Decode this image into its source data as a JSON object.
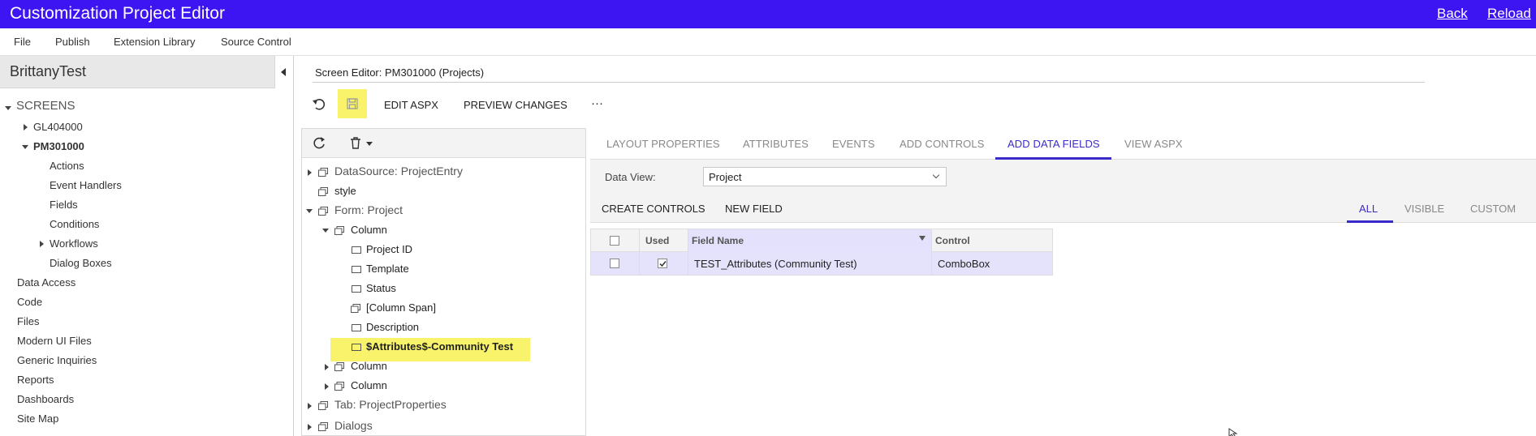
{
  "app": {
    "title": "Customization Project Editor",
    "back_label": "Back",
    "reload_label": "Reload"
  },
  "menu": [
    "File",
    "Publish",
    "Extension Library",
    "Source Control"
  ],
  "project": {
    "name": "BrittanyTest"
  },
  "nav": {
    "screens": "SCREENS",
    "gl": "GL404000",
    "pm": "PM301000",
    "pm_children": [
      "Actions",
      "Event Handlers",
      "Fields",
      "Conditions",
      "Workflows",
      "Dialog Boxes"
    ],
    "sections": [
      "Data Access",
      "Code",
      "Files",
      "Modern UI Files",
      "Generic Inquiries",
      "Reports",
      "Dashboards",
      "Site Map"
    ]
  },
  "editor": {
    "title": "Screen Editor: PM301000 (Projects)",
    "edit_aspx": "EDIT ASPX",
    "preview_changes": "PREVIEW CHANGES",
    "more": "···"
  },
  "tree": {
    "datasource": "DataSource: ProjectEntry",
    "style": "style",
    "form": "Form: Project",
    "column": "Column",
    "fields": [
      "Project ID",
      "Template",
      "Status",
      "[Column Span]",
      "Description"
    ],
    "highlighted": "$Attributes$-Community Test",
    "column2": "Column",
    "column3": "Column",
    "tab": "Tab: ProjectProperties",
    "dialogs": "Dialogs"
  },
  "tabs": [
    "LAYOUT PROPERTIES",
    "ATTRIBUTES",
    "EVENTS",
    "ADD CONTROLS",
    "ADD DATA FIELDS",
    "VIEW ASPX"
  ],
  "data_view": {
    "label": "Data View:",
    "value": "Project",
    "create_controls": "CREATE CONTROLS",
    "new_field": "NEW FIELD",
    "filters": [
      "ALL",
      "VISIBLE",
      "CUSTOM"
    ]
  },
  "grid": {
    "headers": {
      "used": "Used",
      "field_name": "Field Name",
      "control": "Control"
    },
    "rows": [
      {
        "used": true,
        "field_name": "TEST_Attributes (Community Test)",
        "control": "ComboBox"
      }
    ]
  },
  "colors": {
    "titlebar": "#3d14f2",
    "accent": "#3b2cc9",
    "highlight": "#f8f36a"
  }
}
